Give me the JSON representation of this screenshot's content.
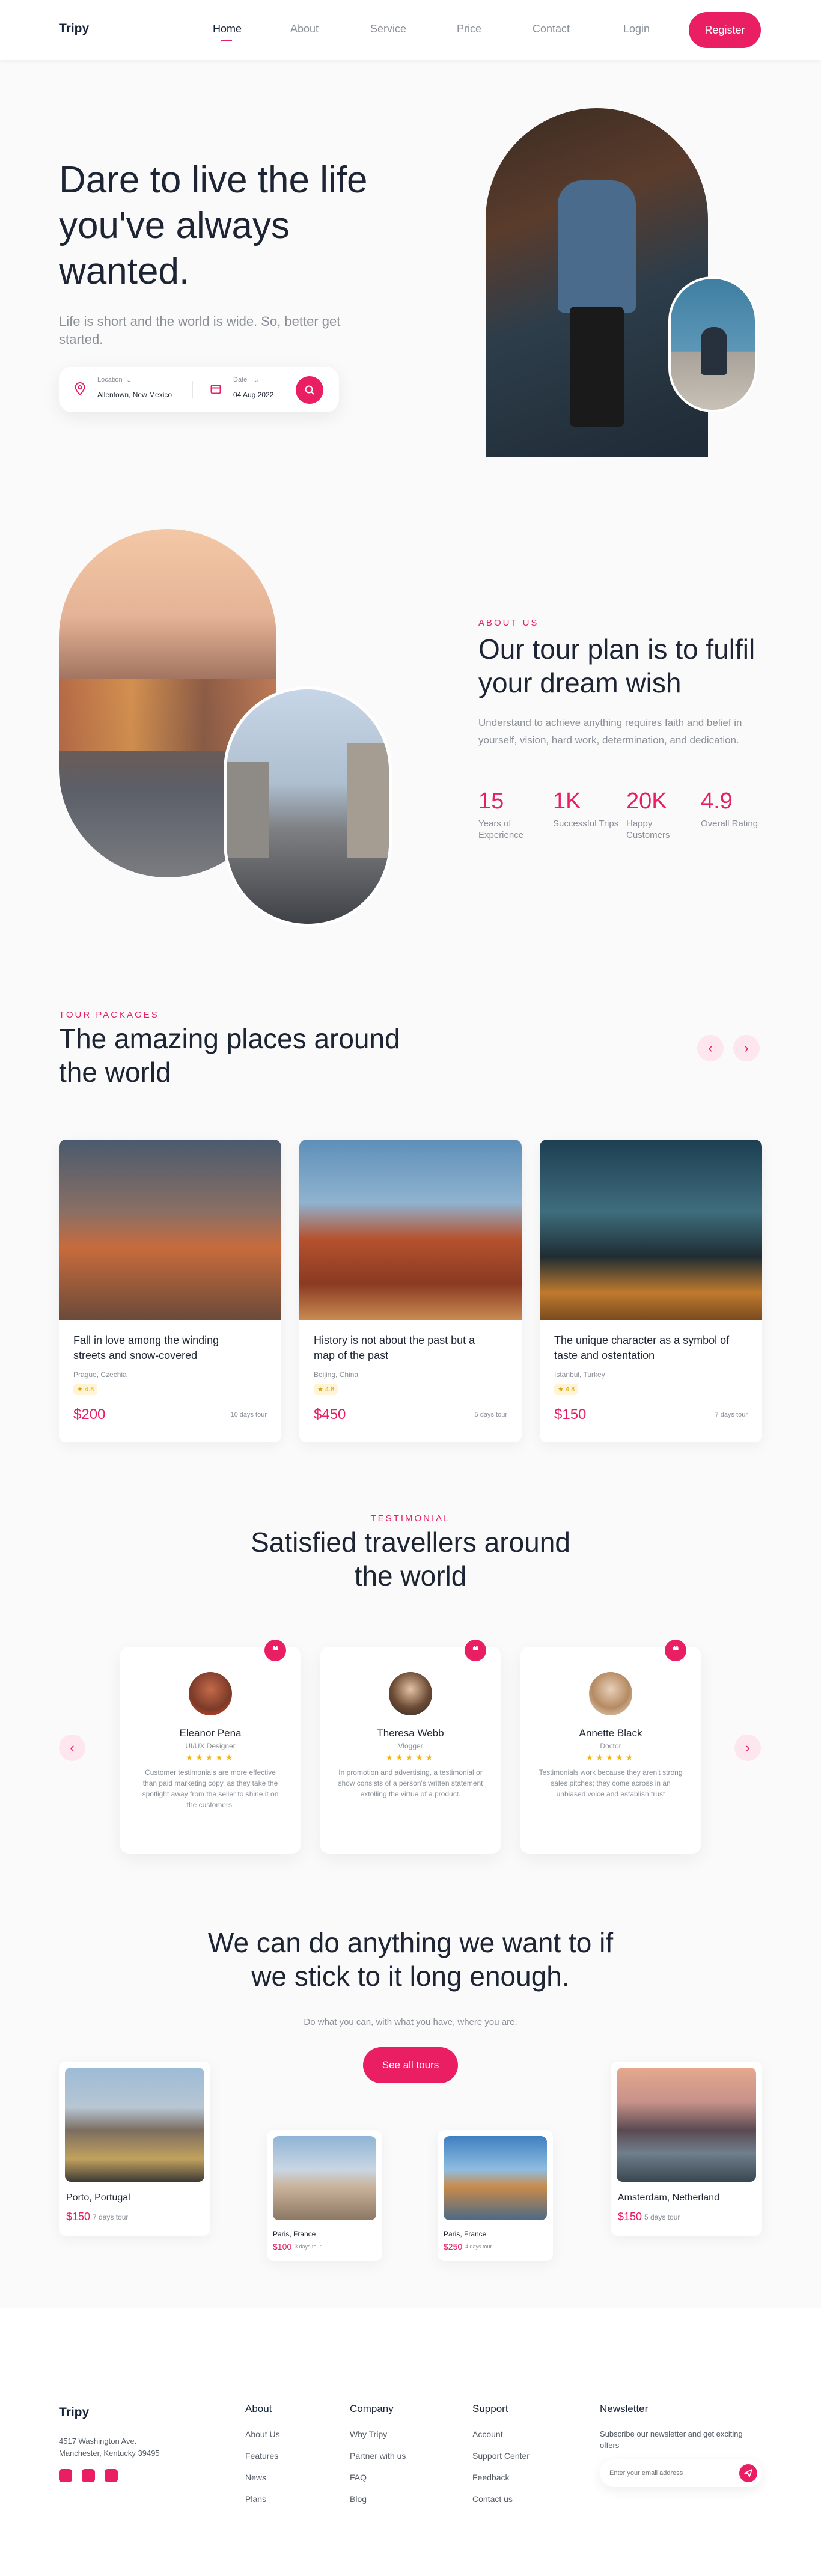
{
  "nav": {
    "logo": "Tripy",
    "links": [
      "Home",
      "About",
      "Service",
      "Price",
      "Contact"
    ],
    "login": "Login",
    "register": "Register"
  },
  "hero": {
    "title": "Dare to live the life you've always wanted.",
    "subtitle": "Life is short and the world is wide. So, better get started.",
    "location_label": "Location",
    "location_value": "Allentown, New Mexico",
    "date_label": "Date",
    "date_value": "04 Aug 2022"
  },
  "about": {
    "eyebrow": "ABOUT US",
    "title": "Our tour plan is to fulfil your dream wish",
    "text": "Understand to achieve anything requires faith and belief in yourself, vision, hard work, determination, and dedication.",
    "stats": [
      {
        "num": "15",
        "label": "Years of Experience"
      },
      {
        "num": "1K",
        "label": "Successful Trips"
      },
      {
        "num": "20K",
        "label": "Happy Customers"
      },
      {
        "num": "4.9",
        "label": "Overall Rating"
      }
    ]
  },
  "packages": {
    "eyebrow": "TOUR PACKAGES",
    "title": "The amazing places around the world",
    "items": [
      {
        "title": "Fall in love among the winding streets and snow-covered",
        "place": "Prague, Czechia",
        "rating": "4.8",
        "price": "$200",
        "days": "10 days tour"
      },
      {
        "title": "History is not about the past but a map of the past",
        "place": "Beijing, China",
        "rating": "4.8",
        "price": "$450",
        "days": "5 days tour"
      },
      {
        "title": "The unique character as a symbol of taste and ostentation",
        "place": "Istanbul, Turkey",
        "rating": "4.8",
        "price": "$150",
        "days": "7 days tour"
      }
    ]
  },
  "testimonial": {
    "eyebrow": "TESTIMONIAL",
    "title": "Satisfied travellers around the world",
    "items": [
      {
        "name": "Eleanor Pena",
        "role": "UI/UX Designer",
        "text": "Customer testimonials are more effective than paid marketing copy, as they take the spotlight away from the seller to shine it on the customers."
      },
      {
        "name": "Theresa Webb",
        "role": "Vlogger",
        "text": "In promotion and advertising, a testimonial or show consists of a person's written statement extolling the virtue of a product."
      },
      {
        "name": "Annette Black",
        "role": "Doctor",
        "text": "Testimonials work because they aren't strong sales pitches; they come across in an unbiased voice and establish trust"
      }
    ]
  },
  "tours": {
    "title": "We can do anything we want to if we stick to it long enough.",
    "subtitle": "Do what you can, with what you have, where you are.",
    "button": "See all tours",
    "items": [
      {
        "name": "Porto, Portugal",
        "price": "$150",
        "days": "7 days tour"
      },
      {
        "name": "Paris, France",
        "price": "$100",
        "days": "3 days tour"
      },
      {
        "name": "Paris, France",
        "price": "$250",
        "days": "4 days tour"
      },
      {
        "name": "Amsterdam, Netherland",
        "price": "$150",
        "days": "5 days tour"
      }
    ]
  },
  "footer": {
    "logo": "Tripy",
    "address": "4517 Washington Ave. Manchester, Kentucky 39495",
    "cols": [
      {
        "title": "About",
        "links": [
          "About Us",
          "Features",
          "News",
          "Plans"
        ]
      },
      {
        "title": "Company",
        "links": [
          "Why Tripy",
          "Partner with us",
          "FAQ",
          "Blog"
        ]
      },
      {
        "title": "Support",
        "links": [
          "Account",
          "Support Center",
          "Feedback",
          "Contact us"
        ]
      }
    ],
    "newsletter_title": "Newsletter",
    "newsletter_text": "Subscribe our newsletter and get exciting offers",
    "email_placeholder": "Enter your email address"
  },
  "colors": {
    "accent": "#e91e63",
    "dark": "#1d2433",
    "muted": "#8a8f98"
  }
}
